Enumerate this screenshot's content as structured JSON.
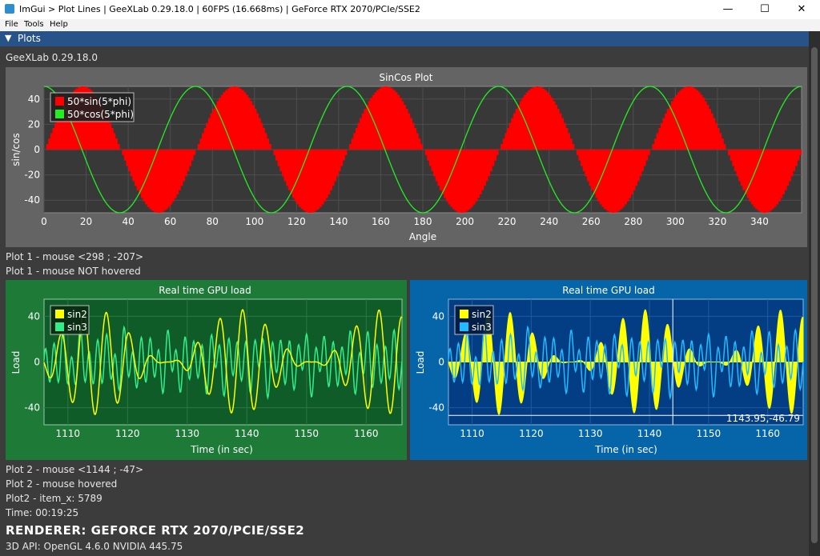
{
  "window": {
    "title": "ImGui > Plot Lines | GeeXLab 0.29.18.0 | 60FPS (16.668ms) | GeForce RTX 2070/PCIe/SSE2",
    "minimize": "—",
    "maximize": "☐",
    "close": "✕"
  },
  "menu": [
    {
      "label": "File"
    },
    {
      "label": "Tools"
    },
    {
      "label": "Help"
    }
  ],
  "section": {
    "label": "Plots",
    "arrow": "▼"
  },
  "app_label": "GeeXLab 0.29.18.0",
  "status": {
    "plot1_mouse": "Plot 1 - mouse <298 ; -207>",
    "plot1_hover": "Plot 1 - mouse NOT hovered",
    "plot2_mouse": "Plot 2 - mouse <1144 ; -47>",
    "plot2_hover": "Plot 2 - mouse hovered",
    "plot2_item": "Plot2 - item_x: 5789",
    "time": "Time: 00:19:25",
    "renderer": "RENDERER: GEFORCE RTX 2070/PCIE/SSE2",
    "api": "3D API: OpenGL 4.6.0 NVIDIA 445.75"
  },
  "colors": {
    "sincos_frame": "#646464",
    "sincos_plot": "#383838",
    "sin_fill": "#ff0000",
    "cos_line": "#22ee22",
    "gpu1_frame": "#1d7a37",
    "gpu1_plot": "#0f5c28",
    "gpu2_frame": "#0565a8",
    "gpu2_plot": "#033e85",
    "sin2": "#ffff00",
    "sin3_green": "#33ee88",
    "sin3_blue": "#22bbff"
  },
  "chart_data": [
    {
      "type": "area",
      "title": "SinCos Plot",
      "xlabel": "Angle",
      "ylabel": "sin/cos",
      "xlim": [
        0,
        360
      ],
      "ylim": [
        -50,
        50
      ],
      "xticks": [
        0,
        20,
        40,
        60,
        80,
        100,
        120,
        140,
        160,
        180,
        200,
        220,
        240,
        260,
        280,
        300,
        320,
        340
      ],
      "yticks": [
        40,
        20,
        0,
        -20,
        -40
      ],
      "grid": true,
      "legend": "top-left",
      "series": [
        {
          "name": "50*sin(5*phi)",
          "kind": "shaded",
          "amplitude": 50,
          "frequency": 5
        },
        {
          "name": "50*cos(5*phi)",
          "kind": "line",
          "amplitude": 50,
          "frequency": 5
        }
      ]
    },
    {
      "type": "line",
      "title": "Real time GPU load",
      "xlabel": "Time (in sec)",
      "ylabel": "Load",
      "xlim": [
        1106,
        1166
      ],
      "ylim": [
        -55,
        55
      ],
      "xticks": [
        1110,
        1120,
        1130,
        1140,
        1150,
        1160
      ],
      "yticks": [
        40,
        0,
        -40
      ],
      "grid": true,
      "legend": "top-left",
      "series": [
        {
          "name": "sin2",
          "kind": "line"
        },
        {
          "name": "sin3",
          "kind": "line"
        }
      ]
    },
    {
      "type": "area",
      "title": "Real time GPU load",
      "xlabel": "Time (in sec)",
      "ylabel": "Load",
      "xlim": [
        1106,
        1166
      ],
      "ylim": [
        -55,
        55
      ],
      "xticks": [
        1110,
        1120,
        1130,
        1140,
        1150,
        1160
      ],
      "yticks": [
        40,
        0,
        -40
      ],
      "grid": true,
      "legend": "top-left",
      "cursor": {
        "x": 1143.95,
        "y": -46.79,
        "label": "1143.95,-46.79"
      },
      "series": [
        {
          "name": "sin2",
          "kind": "shaded"
        },
        {
          "name": "sin3",
          "kind": "line"
        }
      ]
    }
  ]
}
